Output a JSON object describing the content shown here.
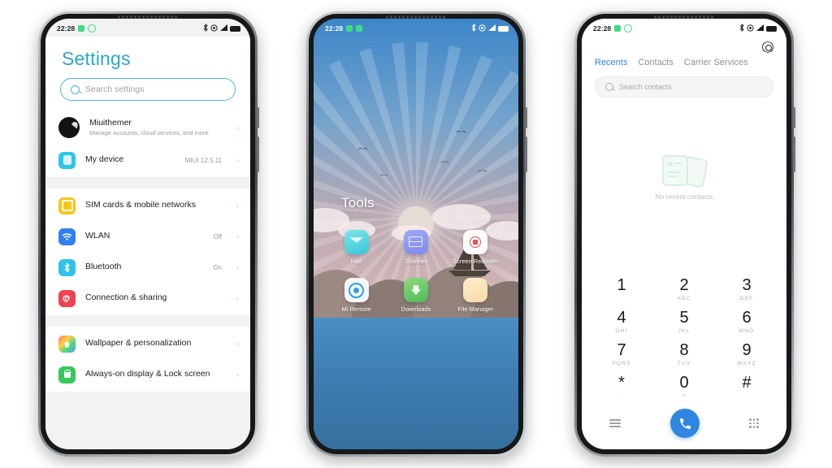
{
  "status_bar": {
    "time": "22:28",
    "icons_left": [
      "whatsapp-badge",
      "app-badge-ring"
    ],
    "icons_right": [
      "bluetooth-icon",
      "location-icon",
      "signal-icon",
      "battery-icon"
    ]
  },
  "settings_phone": {
    "title": "Settings",
    "search": {
      "placeholder": "Search settings"
    },
    "groups": [
      {
        "rows": [
          {
            "icon": "account-avatar",
            "label": "Miuithemer",
            "sublabel": "Manage accounts, cloud services, and more",
            "value": "",
            "chevron": "›"
          },
          {
            "icon": "device-icon",
            "label": "My device",
            "sublabel": "",
            "value": "MIUI 12.5.11",
            "chevron": "›"
          }
        ]
      },
      {
        "rows": [
          {
            "icon": "sim-icon",
            "label": "SIM cards & mobile networks",
            "sublabel": "",
            "value": "",
            "chevron": "›"
          },
          {
            "icon": "wlan-icon",
            "label": "WLAN",
            "sublabel": "",
            "value": "Off",
            "chevron": "›"
          },
          {
            "icon": "bluetooth-icon",
            "label": "Bluetooth",
            "sublabel": "",
            "value": "On",
            "chevron": "›"
          },
          {
            "icon": "connection-icon",
            "label": "Connection & sharing",
            "sublabel": "",
            "value": "",
            "chevron": "›"
          }
        ]
      },
      {
        "rows": [
          {
            "icon": "wallpaper-icon",
            "label": "Wallpaper & personalization",
            "sublabel": "",
            "value": "",
            "chevron": "›"
          },
          {
            "icon": "lock-icon",
            "label": "Always-on display & Lock screen",
            "sublabel": "",
            "value": "",
            "chevron": "›"
          }
        ]
      }
    ]
  },
  "home_phone": {
    "folder_title": "Tools",
    "app_rows": [
      [
        {
          "icon": "mail-icon",
          "label": "Mail"
        },
        {
          "icon": "scanner-icon",
          "label": "Scanner"
        },
        {
          "icon": "screen-recorder-icon",
          "label": "Screen Recorder"
        }
      ],
      [
        {
          "icon": "mi-remote-icon",
          "label": "Mi Remote"
        },
        {
          "icon": "downloads-icon",
          "label": "Downloads"
        },
        {
          "icon": "file-manager-icon",
          "label": "File Manager"
        }
      ]
    ]
  },
  "dialer_phone": {
    "settings_icon": "gear-icon",
    "tabs": [
      {
        "label": "Recents",
        "active": true
      },
      {
        "label": "Contacts",
        "active": false
      },
      {
        "label": "Carrier Services",
        "active": false
      }
    ],
    "search": {
      "placeholder": "Search contacts"
    },
    "empty_state": {
      "text": "No recent contacts",
      "art": "contact-cards-icon"
    },
    "keypad": [
      [
        {
          "digit": "1",
          "letters": ""
        },
        {
          "digit": "2",
          "letters": "ABC"
        },
        {
          "digit": "3",
          "letters": "DEF"
        }
      ],
      [
        {
          "digit": "4",
          "letters": "GHI"
        },
        {
          "digit": "5",
          "letters": "JKL"
        },
        {
          "digit": "6",
          "letters": "MNO"
        }
      ],
      [
        {
          "digit": "7",
          "letters": "PQRS"
        },
        {
          "digit": "8",
          "letters": "TUV"
        },
        {
          "digit": "9",
          "letters": "WXYZ"
        }
      ],
      [
        {
          "digit": "*",
          "letters": ","
        },
        {
          "digit": "0",
          "letters": "+"
        },
        {
          "digit": "#",
          "letters": ""
        }
      ]
    ],
    "bottom_bar": {
      "left_icon": "menu-icon",
      "call_icon": "phone-icon",
      "right_icon": "keypad-icon"
    }
  },
  "colors": {
    "settings_accent": "#2aa9c4",
    "dialer_accent": "#2f86e0",
    "wallpaper_sky": "#3c86c9",
    "wallpaper_sea": "#4a8fc4"
  }
}
